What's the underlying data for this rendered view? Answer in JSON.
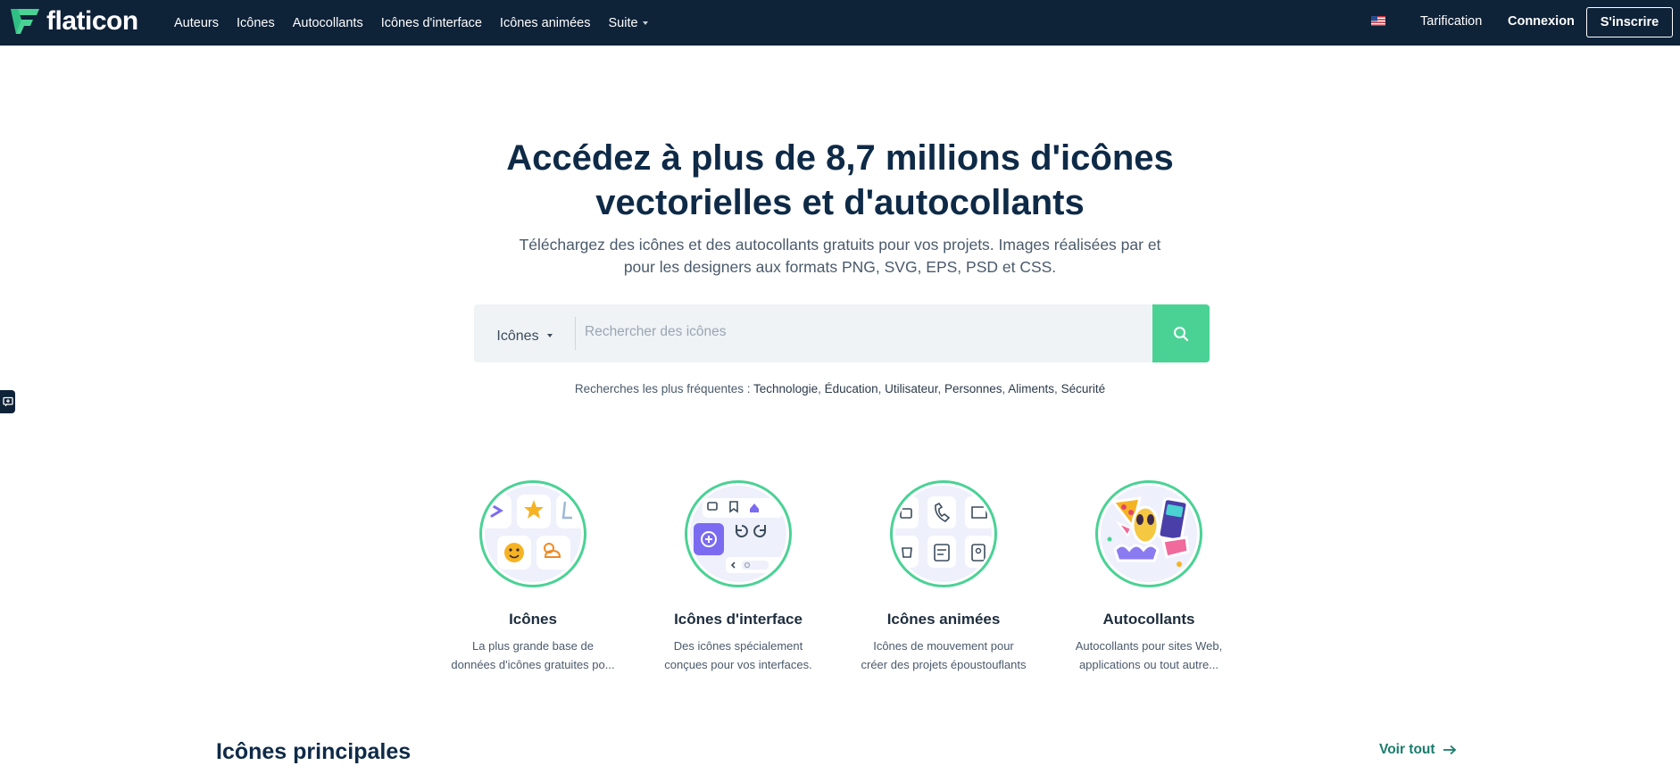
{
  "nav": {
    "brand": "flaticon",
    "links": [
      "Auteurs",
      "Icônes",
      "Autocollants",
      "Icônes d'interface",
      "Icônes animées"
    ],
    "more": "Suite",
    "flag_icon": "us-flag-icon",
    "pricing": "Tarification",
    "login": "Connexion",
    "signup": "S'inscrire"
  },
  "hero": {
    "title_line1": "Accédez à plus de 8,7 millions d'icônes",
    "title_line2": "vectorielles et d'autocollants",
    "subtitle_line1": "Téléchargez des icônes et des autocollants gratuits pour vos projets. Images réalisées par et",
    "subtitle_line2": "pour les designers aux formats PNG, SVG, EPS, PSD et CSS."
  },
  "search": {
    "type": "Icônes",
    "placeholder": "Rechercher des icônes"
  },
  "frequent": {
    "label": "Recherches les plus fréquentes :",
    "terms": [
      "Technologie",
      "Éducation",
      "Utilisateur",
      "Personnes",
      "Aliments",
      "Sécurité"
    ]
  },
  "categories": [
    {
      "title": "Icônes",
      "desc1": "La plus grande base de",
      "desc2": "données d'icônes gratuites po..."
    },
    {
      "title": "Icônes d'interface",
      "desc1": "Des icônes spécialement",
      "desc2": "conçues pour vos interfaces."
    },
    {
      "title": "Icônes animées",
      "desc1": "Icônes de mouvement pour",
      "desc2": "créer des projets époustouflants"
    },
    {
      "title": "Autocollants",
      "desc1": "Autocollants pour sites Web,",
      "desc2": "applications ou tout autre..."
    }
  ],
  "section": {
    "title": "Icônes principales",
    "see_all": "Voir tout"
  },
  "colors": {
    "nav_bg": "#0e2238",
    "accent_green": "#4ad295",
    "link_teal": "#1a7c6b",
    "title_navy": "#0e2a47"
  }
}
